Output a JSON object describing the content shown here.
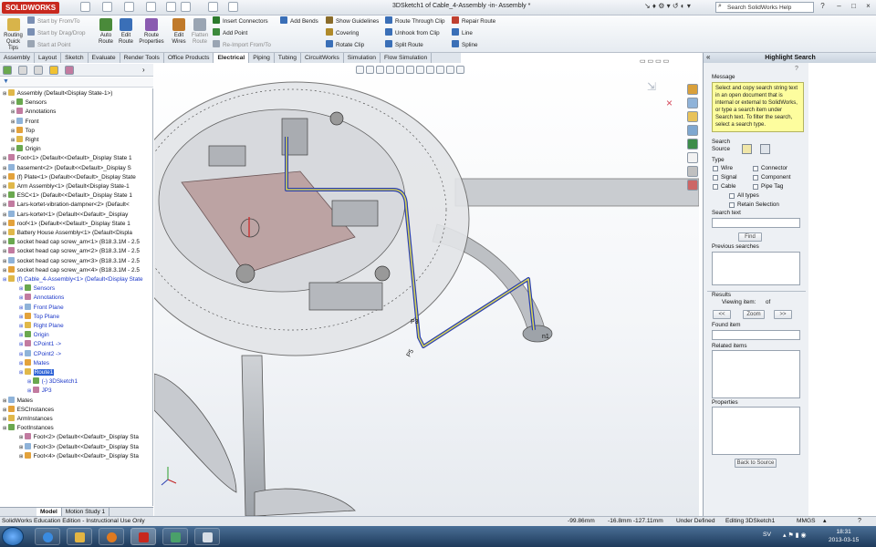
{
  "app": {
    "logo": "SOLIDWORKS",
    "title": "3DSketch1 of Cable_4-Assembly -in- Assembly *",
    "search_placeholder": "Search SolidWorks Help",
    "brand_red": "#c8281e"
  },
  "ribbon": {
    "routing_quick_tips": "Routing Quick Tips",
    "start_by_from_to": "Start by From/To",
    "start_by_drag_drop": "Start by Drag/Drop",
    "start_at_point": "Start at Point",
    "auto_route": "Auto Route",
    "edit_route": "Edit Route",
    "route_properties": "Route Properties",
    "edit_wires": "Edit Wires",
    "flatten_route": "Flatten Route",
    "insert_connectors": "Insert Connectors",
    "add_point": "Add Point",
    "reimport_from_to": "Re-Import From/To",
    "add_bends": "Add Bends",
    "show_guidelines": "Show Guidelines",
    "covering": "Covering",
    "rotate_clip": "Rotate Clip",
    "route_through_clip": "Route Through Clip",
    "unhook_from_clip": "Unhook from Clip",
    "split_route": "Split Route",
    "repair_route": "Repair Route",
    "line": "Line",
    "spline": "Spline"
  },
  "tabs": [
    "Assembly",
    "Layout",
    "Sketch",
    "Evaluate",
    "Render Tools",
    "Office Products",
    "Electrical",
    "Piping",
    "Tubing",
    "CircuitWorks",
    "Simulation",
    "Flow Simulation"
  ],
  "active_tab": "Electrical",
  "tree": [
    {
      "label": "Assembly  (Default<Display State-1>)",
      "indent": 0,
      "blue": false
    },
    {
      "label": "Sensors",
      "indent": 1,
      "blue": false
    },
    {
      "label": "Annotations",
      "indent": 1,
      "blue": false
    },
    {
      "label": "Front",
      "indent": 1,
      "blue": false
    },
    {
      "label": "Top",
      "indent": 1,
      "blue": false
    },
    {
      "label": "Right",
      "indent": 1,
      "blue": false
    },
    {
      "label": "Origin",
      "indent": 1,
      "blue": false
    },
    {
      "label": "Foot<1> (Default<<Default>_Display State 1",
      "indent": 0,
      "blue": false
    },
    {
      "label": "basement<2> (Default<<Default>_Display S",
      "indent": 0,
      "blue": false
    },
    {
      "label": "(f) Plate<1> (Default<<Default>_Display State",
      "indent": 0,
      "blue": false
    },
    {
      "label": "Arm Assembly<1> (Default<Display State-1",
      "indent": 0,
      "blue": false
    },
    {
      "label": "ESC<1> (Default<<Default>_Display State 1",
      "indent": 0,
      "blue": false
    },
    {
      "label": "Lars-kortet-vibration-dampner<2> (Default<",
      "indent": 0,
      "blue": false
    },
    {
      "label": "Lars-kortet<1> (Default<<Default>_Display",
      "indent": 0,
      "blue": false
    },
    {
      "label": "roof<1> (Default<<Default>_Display State 1",
      "indent": 0,
      "blue": false
    },
    {
      "label": "Battery House Assembly<1> (Default<Displa",
      "indent": 0,
      "blue": false
    },
    {
      "label": "socket head cap screw_am<1> (B18.3.1M - 2.5",
      "indent": 0,
      "blue": false
    },
    {
      "label": "socket head cap screw_am<2> (B18.3.1M - 2.5",
      "indent": 0,
      "blue": false
    },
    {
      "label": "socket head cap screw_am<3> (B18.3.1M - 2.5",
      "indent": 0,
      "blue": false
    },
    {
      "label": "socket head cap screw_am<4> (B18.3.1M - 2.5",
      "indent": 0,
      "blue": false
    },
    {
      "label": "(f) Cable_4-Assembly<1> (Default<Display State",
      "indent": 0,
      "blue": true
    },
    {
      "label": "Sensors",
      "indent": 2,
      "blue": true
    },
    {
      "label": "Annotations",
      "indent": 2,
      "blue": true
    },
    {
      "label": "Front Plane",
      "indent": 2,
      "blue": true
    },
    {
      "label": "Top Plane",
      "indent": 2,
      "blue": true
    },
    {
      "label": "Right Plane",
      "indent": 2,
      "blue": true
    },
    {
      "label": "Origin",
      "indent": 2,
      "blue": true
    },
    {
      "label": "CPoint1 ->",
      "indent": 2,
      "blue": true
    },
    {
      "label": "CPoint2 ->",
      "indent": 2,
      "blue": true
    },
    {
      "label": "Mates",
      "indent": 2,
      "blue": true
    },
    {
      "label": "Route1",
      "indent": 2,
      "blue": true,
      "selected": true
    },
    {
      "label": "(-) 3DSketch1",
      "indent": 3,
      "blue": true
    },
    {
      "label": "JP3",
      "indent": 3,
      "blue": true
    },
    {
      "label": "Mates",
      "indent": 0,
      "blue": false
    },
    {
      "label": "ESCInstances",
      "indent": 0,
      "blue": false
    },
    {
      "label": "ArmInstances",
      "indent": 0,
      "blue": false
    },
    {
      "label": "FootInstances",
      "indent": 0,
      "blue": false
    },
    {
      "label": "Foot<2> (Default<<Default>_Display Sta",
      "indent": 2,
      "blue": false
    },
    {
      "label": "Foot<3> (Default<<Default>_Display Sta",
      "indent": 2,
      "blue": false
    },
    {
      "label": "Foot<4> (Default<<Default>_Display Sta",
      "indent": 2,
      "blue": false
    }
  ],
  "bottom_tabs": [
    "Model",
    "Motion Study 1"
  ],
  "viewport": {
    "label_p3": "P3",
    "label_p5": "P5",
    "label_n1": "n1"
  },
  "right_panel": {
    "title": "Highlight Search",
    "message_label": "Message",
    "message": "Select and copy search string text in an open document that is internal or external to SolidWorks, or type a search item under Search text. To filter the search, select a search type.",
    "search_source_label": "Search Source",
    "type_label": "Type",
    "types_left": [
      "Wire",
      "Signal",
      "Cable"
    ],
    "types_right": [
      "Connector",
      "Component",
      "Pipe Tag"
    ],
    "all_types": "All types",
    "retain_selection": "Retain Selection",
    "search_text_label": "Search text",
    "find_button": "Find",
    "previous_searches_label": "Previous searches",
    "results_label": "Results",
    "viewing_item_label": "Viewing item:",
    "of_label": "of",
    "prev_button": "<<",
    "zoom_button": "Zoom",
    "next_button": ">>",
    "found_item_label": "Found item",
    "related_items_label": "Related items",
    "properties_label": "Properties",
    "back_button": "Back to Source"
  },
  "status": {
    "edition": "SolidWorks Education Edition - Instructional Use Only",
    "x": "-99.86mm",
    "y": "-16.8mm -127.11mm",
    "state": "Under Defined",
    "editing": "Editing 3DSketch1",
    "units": "MMGS"
  },
  "taskbar": {
    "lang": "SV",
    "time": "18:31",
    "date": "2013-03-15"
  }
}
